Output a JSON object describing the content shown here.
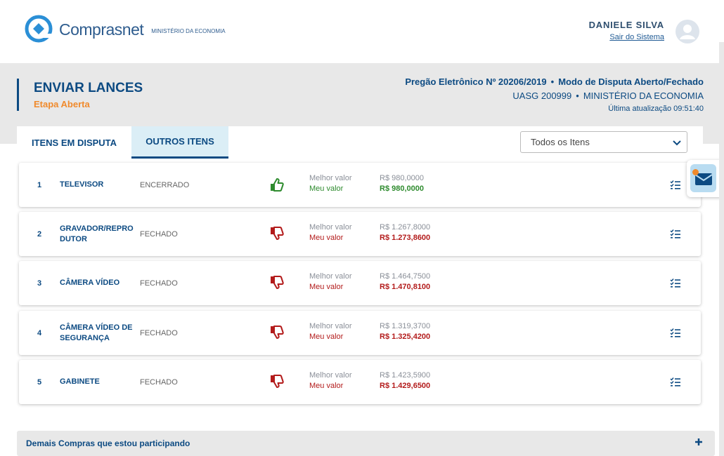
{
  "header": {
    "logo_name": "Comprasnet",
    "logo_subtitle": "MINISTÉRIO DA ECONOMIA",
    "user_name": "DANIELE SILVA",
    "logout_label": "Sair do Sistema"
  },
  "page": {
    "title": "ENVIAR LANCES",
    "stage": "Etapa Aberta",
    "pregao": "Pregão Eletrônico Nº 20206/2019",
    "modo": "Modo de Disputa Aberto/Fechado",
    "uasg": "UASG 200999",
    "orgao": "MINISTÉRIO DA ECONOMIA",
    "last_update": "Última atualização 09:51:40",
    "separator": "•"
  },
  "tabs": [
    {
      "label": "ITENS EM DISPUTA",
      "active": false
    },
    {
      "label": "OUTROS ITENS",
      "active": true
    }
  ],
  "filter": {
    "selected": "Todos os Itens"
  },
  "labels": {
    "best": "Melhor valor",
    "mine": "Meu valor"
  },
  "items": [
    {
      "num": "1",
      "name": "TELEVISOR",
      "status": "ENCERRADO",
      "thumb": "up",
      "best": "R$ 980,0000",
      "mine": "R$ 980,0000"
    },
    {
      "num": "2",
      "name": "GRAVADOR/REPRO DUTOR",
      "status": "FECHADO",
      "thumb": "down",
      "best": "R$ 1.267,8000",
      "mine": "R$ 1.273,8600"
    },
    {
      "num": "3",
      "name": "CÂMERA VÍDEO",
      "status": "FECHADO",
      "thumb": "down",
      "best": "R$ 1.464,7500",
      "mine": "R$ 1.470,8100"
    },
    {
      "num": "4",
      "name": "CÂMERA VÍDEO DE SEGURANÇA",
      "status": "FECHADO",
      "thumb": "down",
      "best": "R$ 1.319,3700",
      "mine": "R$ 1.325,4200"
    },
    {
      "num": "5",
      "name": "GABINETE",
      "status": "FECHADO",
      "thumb": "down",
      "best": "R$ 1.423,5900",
      "mine": "R$ 1.429,6500"
    }
  ],
  "other_purchases": {
    "label": "Demais Compras que estou participando"
  },
  "colors": {
    "primary": "#0c4a82",
    "accent_orange": "#f08a2c",
    "winning_green": "#2e8b2e",
    "losing_red": "#b31b1b",
    "tab_active_bg": "#dbeef6",
    "page_gray": "#e8e8e8"
  },
  "icons": {
    "logo": "comprasnet-logo-icon",
    "avatar": "user-avatar-icon",
    "thumb_up": "thumbs-up-icon",
    "thumb_down": "thumbs-down-icon",
    "list": "checklist-icon",
    "dropdown": "chevron-down-icon",
    "mail": "mail-icon",
    "expand": "plus-icon"
  }
}
